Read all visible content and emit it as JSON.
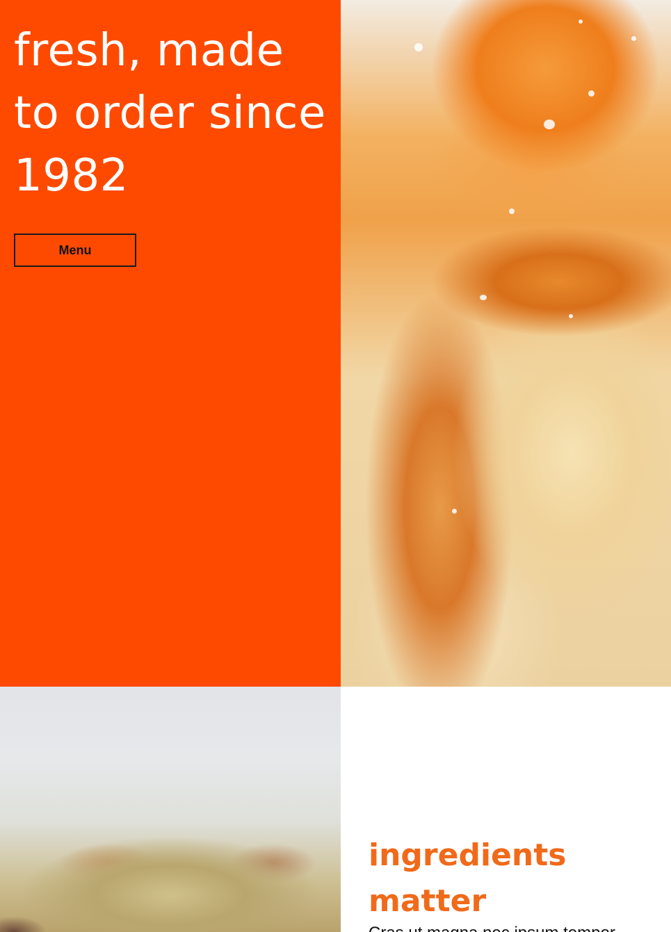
{
  "hero": {
    "title": "fresh, made to order since 1982",
    "menu_label": "Menu",
    "background_color": "#fe4a00"
  },
  "images": {
    "top_right": "glazed-chicken-photo",
    "bottom_left": "blurred-dish-photo"
  },
  "ingredients": {
    "heading": "ingredients matter",
    "body": "Cras ut magna nec ipsum tempor blandit.",
    "heading_color": "#f06a1a"
  }
}
